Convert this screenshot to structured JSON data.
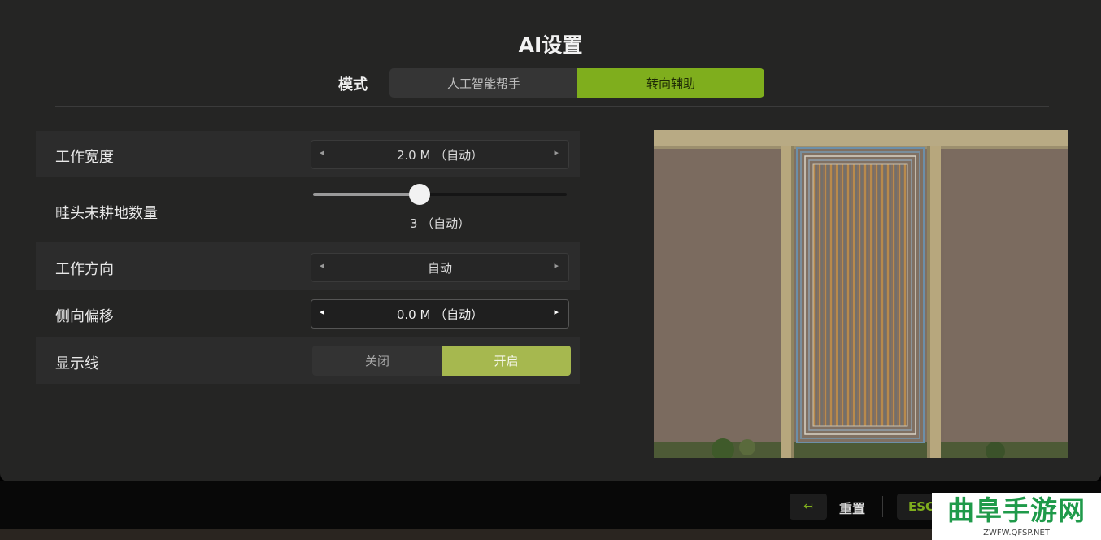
{
  "title": "AI设置",
  "mode": {
    "label": "模式",
    "options": [
      "人工智能帮手",
      "转向辅助"
    ],
    "selected": "转向辅助",
    "accent_color": "#7fae1d"
  },
  "settings": {
    "work_width": {
      "label": "工作宽度",
      "value": "2.0 M （自动）"
    },
    "headland": {
      "label": "畦头未耕地数量",
      "value_text": "3 （自动）",
      "slider_fraction": 0.42
    },
    "work_direction": {
      "label": "工作方向",
      "value": "自动"
    },
    "side_offset": {
      "label": "侧向偏移",
      "value": "0.0 M （自动）"
    },
    "show_lines": {
      "label": "显示线",
      "options": [
        "关闭",
        "开启"
      ],
      "selected": "开启",
      "on_color": "#a6b84f"
    }
  },
  "icons": {
    "left_arrow": "◂",
    "right_arrow": "▸",
    "reset_key": "↤"
  },
  "footer": {
    "reset_label": "重置",
    "back_key": "ESC"
  },
  "watermark": {
    "main": "曲阜手游网",
    "sub": "ZWFW.QFSP.NET"
  }
}
